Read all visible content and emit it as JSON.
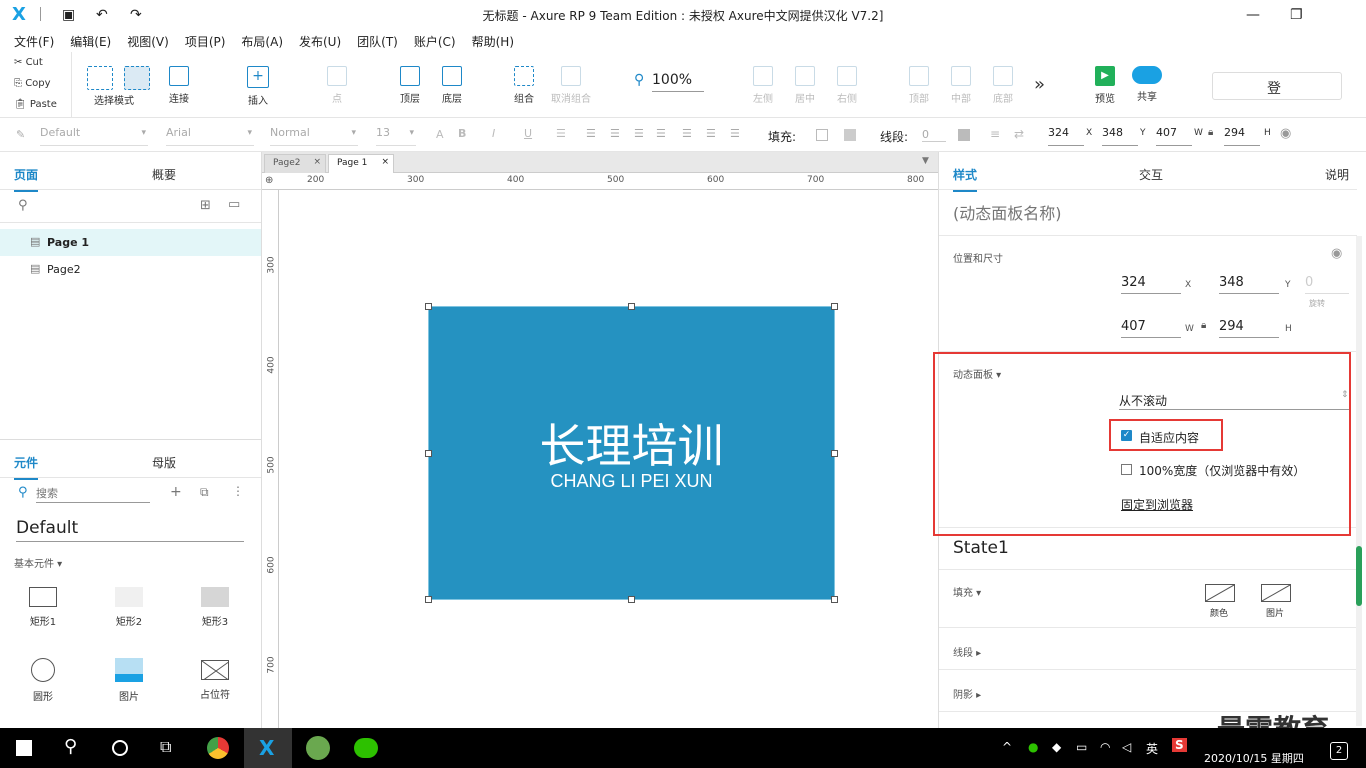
{
  "window": {
    "title": "无标题 - Axure RP 9 Team Edition : 未授权    Axure中文网提供汉化 V7.2]",
    "logo": "X"
  },
  "menu": [
    "文件(F)",
    "编辑(E)",
    "视图(V)",
    "项目(P)",
    "布局(A)",
    "发布(U)",
    "团队(T)",
    "账户(C)",
    "帮助(H)"
  ],
  "clipboard": {
    "cut": "Cut",
    "copy": "Copy",
    "paste": "Paste"
  },
  "toolbar": {
    "select_mode": "选择模式",
    "connect": "连接",
    "insert": "插入",
    "point": "点",
    "top_layer": "顶层",
    "bottom_layer": "底层",
    "group": "组合",
    "ungroup": "取消组合",
    "zoom": "100%",
    "left": "左侧",
    "center": "居中",
    "right": "右侧",
    "top": "顶部",
    "middle": "中部",
    "bottom": "底部",
    "more": "»",
    "preview": "预览",
    "share": "共享",
    "login": "登"
  },
  "format": {
    "style": "Default",
    "font": "Arial",
    "weight": "Normal",
    "size": "13",
    "fill_label": "填充:",
    "stroke_label": "线段:",
    "stroke_value": "0",
    "x": "324",
    "y": "348",
    "w": "407",
    "h": "294",
    "x_unit": "X",
    "y_unit": "Y",
    "w_unit": "W",
    "h_unit": "H"
  },
  "pages_panel": {
    "tab_pages": "页面",
    "tab_outline": "概要",
    "pages": [
      "Page 1",
      "Page2"
    ]
  },
  "widgets_panel": {
    "tab_widgets": "元件",
    "tab_masters": "母版",
    "search_placeholder": "搜索",
    "library": "Default",
    "category": "基本元件 ▾",
    "items": [
      "矩形1",
      "矩形2",
      "矩形3",
      "圆形",
      "图片",
      "占位符"
    ]
  },
  "doc_tabs": [
    "Page2",
    "Page 1"
  ],
  "ruler": {
    "h": [
      "200",
      "300",
      "400",
      "500",
      "600",
      "700",
      "800"
    ],
    "v": [
      "300",
      "400",
      "500",
      "600",
      "700"
    ]
  },
  "canvas": {
    "title": "长理培训",
    "subtitle": "CHANG LI PEI XUN"
  },
  "right_panel": {
    "tab_style": "样式",
    "tab_interaction": "交互",
    "tab_notes": "说明",
    "panel_name_placeholder": "(动态面板名称)",
    "pos_size_label": "位置和尺寸",
    "x": "324",
    "y": "348",
    "rotation": "0",
    "rotation_label": "旋转",
    "w": "407",
    "h": "294",
    "dp_label": "动态面板 ▾",
    "scroll": "从不滚动",
    "fit_content": "自适应内容",
    "fit_content_checked": true,
    "full_width": "100%宽度（仅浏览器中有效）",
    "pin_browser": "固定到浏览器",
    "state": "State1",
    "fill_label": "填充 ▾",
    "fill_color": "颜色",
    "fill_image": "图片",
    "stroke_label": "线段 ▸",
    "shadow_label": "阴影 ▸"
  },
  "watermark": "最需教育",
  "taskbar": {
    "ime": "英",
    "datetime": "2020/10/15 星期四",
    "badge": "2"
  },
  "colors": {
    "accent": "#1e88c8",
    "panel_fill": "#2592c1",
    "highlight": "#e53935"
  }
}
